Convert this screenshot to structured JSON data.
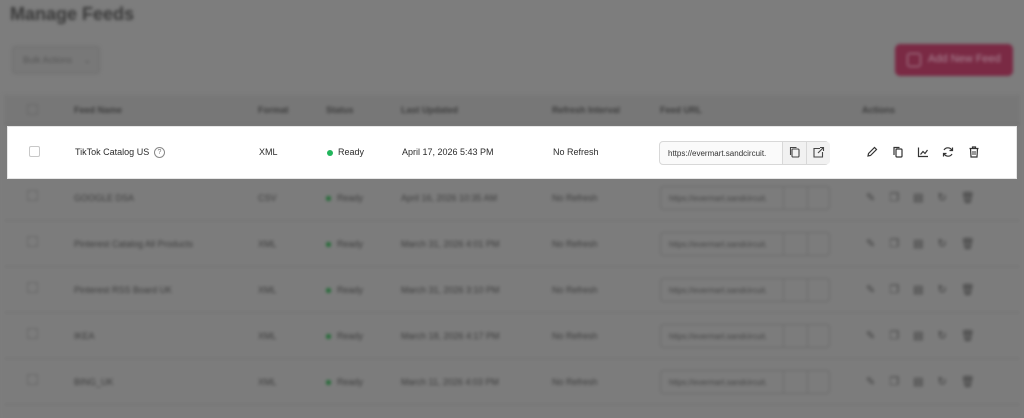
{
  "page": {
    "title": "Manage Feeds",
    "bulk_actions": "Bulk Actions",
    "add_button": "Add New Feed"
  },
  "table": {
    "headers": [
      "Feed Name",
      "Format",
      "Status",
      "Last Updated",
      "Refresh Interval",
      "Feed URL",
      "Actions"
    ],
    "highlighted_row": {
      "name": "TikTok Catalog US",
      "format": "XML",
      "status": "Ready",
      "last_updated": "April 17, 2026 5:43 PM",
      "refresh_interval": "No Refresh",
      "feed_url": "https://evermart.sandcircuit."
    },
    "rows": [
      {
        "name": "GOOGLE DSA",
        "format": "CSV",
        "status": "Ready",
        "last_updated": "April 16, 2026 10:35 AM",
        "refresh_interval": "No Refresh",
        "feed_url": "https://evermart.sandcircuit."
      },
      {
        "name": "Pinterest Catalog All Products",
        "format": "XML",
        "status": "Ready",
        "last_updated": "March 31, 2026 4:01 PM",
        "refresh_interval": "No Refresh",
        "feed_url": "https://evermart.sandcircuit."
      },
      {
        "name": "Pinterest RSS Board UK",
        "format": "XML",
        "status": "Ready",
        "last_updated": "March 31, 2026 3:10 PM",
        "refresh_interval": "No Refresh",
        "feed_url": "https://evermart.sandcircuit."
      },
      {
        "name": "IKEA",
        "format": "XML",
        "status": "Ready",
        "last_updated": "March 18, 2026 4:17 PM",
        "refresh_interval": "No Refresh",
        "feed_url": "https://evermart.sandcircuit."
      },
      {
        "name": "BING_UK",
        "format": "XML",
        "status": "Ready",
        "last_updated": "March 11, 2026 4:03 PM",
        "refresh_interval": "No Refresh",
        "feed_url": "https://evermart.sandcircuit."
      }
    ]
  },
  "colors": {
    "status_ready": "#22b55c",
    "add_button": "#e5316e"
  },
  "icons": [
    "help-icon",
    "copy-icon",
    "open-external-icon",
    "edit-icon",
    "duplicate-icon",
    "chart-icon",
    "refresh-icon",
    "trash-icon",
    "download-icon",
    "plus-icon"
  ]
}
